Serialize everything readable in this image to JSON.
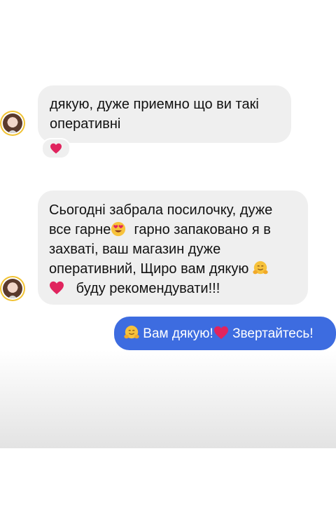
{
  "messages": [
    {
      "direction": "in",
      "lines": [
        "дякую, дуже приемно що ви такі",
        "оперативні"
      ],
      "reaction": "heart-red"
    },
    {
      "direction": "in",
      "lines": [
        "Сьогодні забрала посилочку, дуже",
        "все гарне",
        "гарно запаковано я в",
        "захваті, ваш магазин дуже",
        "оперативний, Щиро вам дякую",
        "буду рекомендувати!!!"
      ],
      "emojis": [
        "heart-eyes-face",
        "hugging-face",
        "heart-red"
      ]
    },
    {
      "direction": "out",
      "text_part1": "Вам дякую!",
      "text_part2": "Звертайтесь!",
      "emojis": [
        "hugging-face",
        "heart-red"
      ]
    }
  ],
  "colors": {
    "incoming_bubble": "#efefef",
    "outgoing_bubble": "#3d6ce0",
    "avatar_ring": "#f1c232",
    "heart": "#e0245e"
  }
}
